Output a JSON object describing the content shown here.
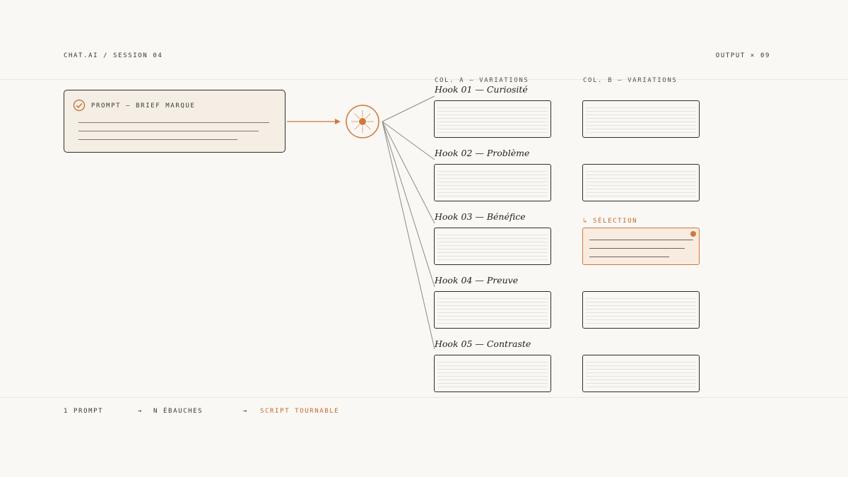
{
  "header": {
    "brand": "CHAT.AI / SESSION 04",
    "output_label": "OUTPUT × 09"
  },
  "prompt_card": {
    "title": "PROMPT — BRIEF MARQUE",
    "icon": "check-circle-icon"
  },
  "hub": {
    "icon": "sun-spark-icon"
  },
  "columns": {
    "a_label": "COL. A — VARIATIONS",
    "b_label": "COL. B — VARIATIONS"
  },
  "hooks": [
    {
      "title": "Hook 01 — Curiosité"
    },
    {
      "title": "Hook 02 — Problème"
    },
    {
      "title": "Hook 03 — Bénéfice"
    },
    {
      "title": "Hook 04 — Preuve"
    },
    {
      "title": "Hook 05 — Contraste"
    }
  ],
  "selection": {
    "label": "↳ SÉLECTION",
    "row": 3
  },
  "footer": {
    "step1": "1 PROMPT",
    "arrow1": "→",
    "step2": "N ÉBAUCHES",
    "arrow2": "→",
    "step3": "SCRIPT TOURNABLE"
  },
  "colors": {
    "accent": "#d2773b",
    "ink": "#2f2d2a",
    "paper": "#faf8f4",
    "card_fill": "#f5eee5"
  }
}
